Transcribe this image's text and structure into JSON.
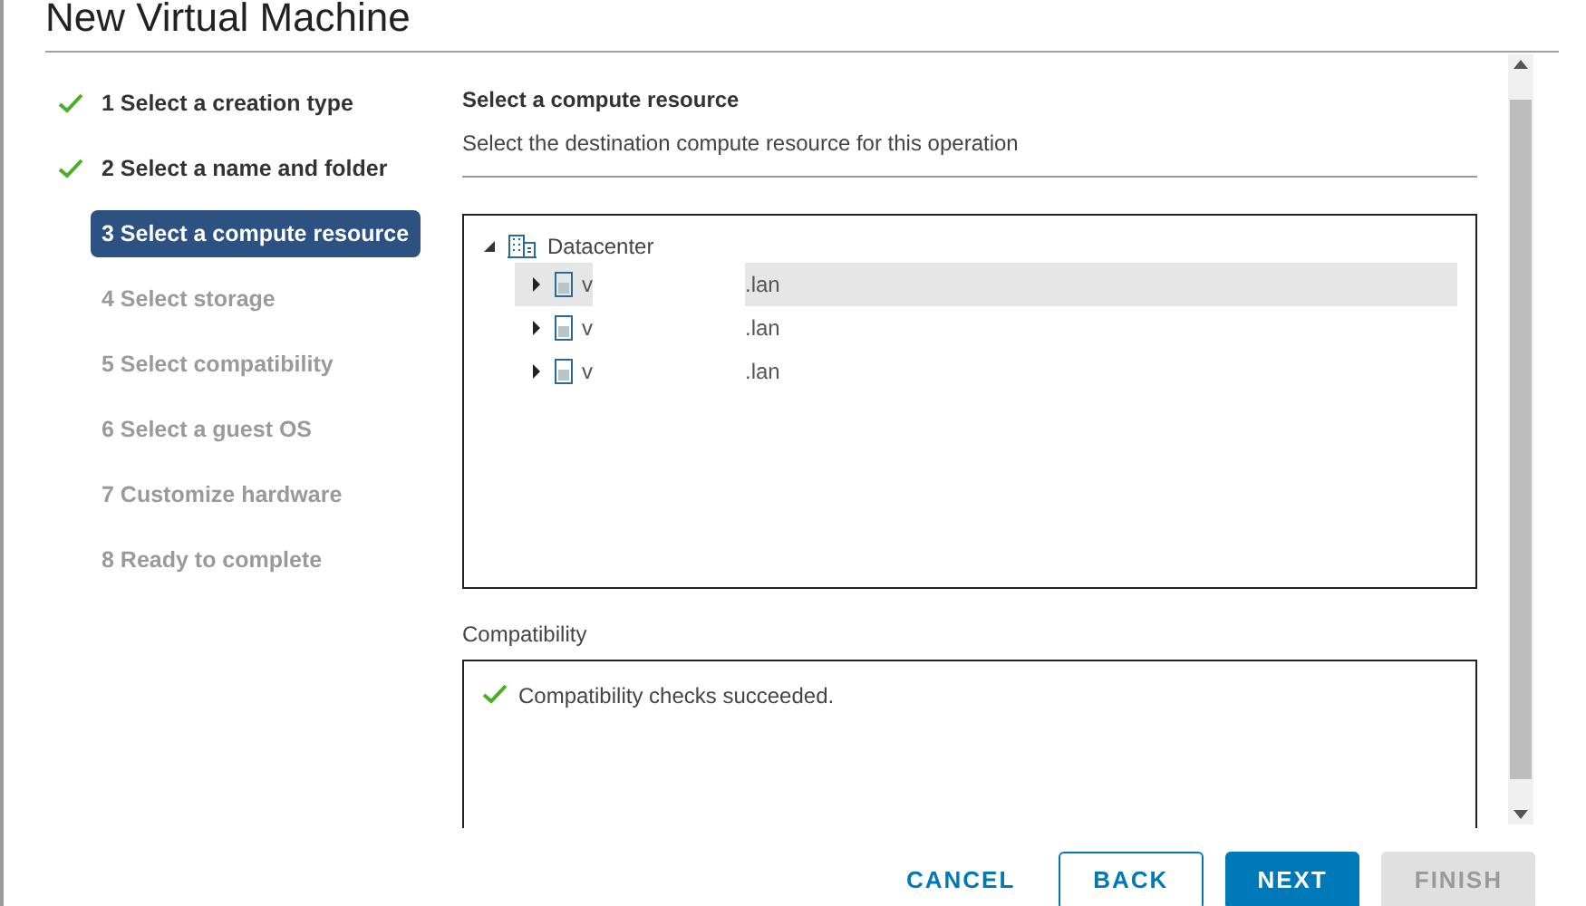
{
  "window": {
    "title": "New Virtual Machine"
  },
  "steps": [
    {
      "label": "1 Select a creation type",
      "completed": true,
      "selected": false,
      "disabled": false
    },
    {
      "label": "2 Select a name and folder",
      "completed": true,
      "selected": false,
      "disabled": false
    },
    {
      "label": "3 Select a compute resource",
      "completed": false,
      "selected": true,
      "disabled": false
    },
    {
      "label": "4 Select storage",
      "completed": false,
      "selected": false,
      "disabled": true
    },
    {
      "label": "5 Select compatibility",
      "completed": false,
      "selected": false,
      "disabled": true
    },
    {
      "label": "6 Select a guest OS",
      "completed": false,
      "selected": false,
      "disabled": true
    },
    {
      "label": "7 Customize hardware",
      "completed": false,
      "selected": false,
      "disabled": true
    },
    {
      "label": "8 Ready to complete",
      "completed": false,
      "selected": false,
      "disabled": true
    }
  ],
  "page": {
    "title": "Select a compute resource",
    "subtitle": "Select the destination compute resource for this operation"
  },
  "tree": {
    "root": {
      "label": "Datacenter",
      "expanded": true
    },
    "children": [
      {
        "prefix": "v",
        "suffix": ".lan",
        "selected": true,
        "expanded": false
      },
      {
        "prefix": "v",
        "suffix": ".lan",
        "selected": false,
        "expanded": false
      },
      {
        "prefix": "v",
        "suffix": ".lan",
        "selected": false,
        "expanded": false
      }
    ]
  },
  "compatibility": {
    "label": "Compatibility",
    "message": "Compatibility checks succeeded."
  },
  "buttons": [
    {
      "label": "CANCEL",
      "kind": "link",
      "disabled": false
    },
    {
      "label": "BACK",
      "kind": "outline",
      "disabled": false
    },
    {
      "label": "NEXT",
      "kind": "primary",
      "disabled": false
    },
    {
      "label": "FINISH",
      "kind": "primary",
      "disabled": true
    }
  ]
}
